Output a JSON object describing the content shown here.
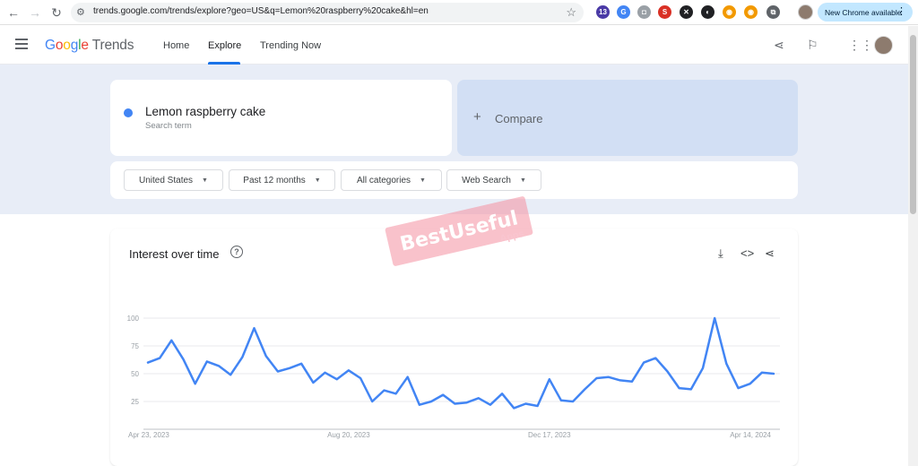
{
  "browser": {
    "url": "trends.google.com/trends/explore?geo=US&q=Lemon%20raspberry%20cake&hl=en",
    "update_label": "New Chrome available",
    "extensions": [
      {
        "name": "hat-extension-icon",
        "text": "13",
        "color": "#4a3aa6"
      },
      {
        "name": "translate-extension-icon",
        "text": "G",
        "color": "#4285f4"
      },
      {
        "name": "camera-extension-icon",
        "text": "◘",
        "color": "#9aa0a6"
      },
      {
        "name": "s-extension-icon",
        "text": "S",
        "color": "#d93025"
      },
      {
        "name": "x-extension-icon",
        "text": "✕",
        "color": "#202124"
      },
      {
        "name": "half-extension-icon",
        "text": "◐",
        "color": "#202124"
      },
      {
        "name": "orange-extension-icon",
        "text": "◉",
        "color": "#f29900"
      },
      {
        "name": "orange2-extension-icon",
        "text": "◉",
        "color": "#f29900"
      },
      {
        "name": "puzzle-extension-icon",
        "text": "⧉",
        "color": "#5f6368"
      }
    ]
  },
  "header": {
    "logo_google": "Google",
    "logo_product": "Trends",
    "tabs": [
      "Home",
      "Explore",
      "Trending Now"
    ]
  },
  "search": {
    "term": "Lemon raspberry cake",
    "term_sub": "Search term",
    "compare": "Compare",
    "term_color": "#4285f4"
  },
  "filters": [
    "United States",
    "Past 12 months",
    "All categories",
    "Web Search"
  ],
  "watermark": {
    "main": "BestUseful",
    "sub": "Apps"
  },
  "chart_data": {
    "type": "line",
    "title": "Interest over time",
    "y_ticks": [
      "100",
      "75",
      "50",
      "25"
    ],
    "ylim": [
      0,
      100
    ],
    "x_tick_labels": [
      "Apr 23, 2023",
      "Aug 20, 2023",
      "Dec 17, 2023",
      "Apr 14, 2024"
    ],
    "x_tick_index": [
      0,
      17,
      34,
      51
    ],
    "series": [
      {
        "color": "#4285f4",
        "values": [
          60,
          64,
          80,
          63,
          41,
          61,
          57,
          49,
          65,
          91,
          66,
          52,
          55,
          59,
          42,
          51,
          45,
          53,
          46,
          25,
          35,
          32,
          47,
          22,
          25,
          31,
          23,
          24,
          28,
          22,
          32,
          19,
          23,
          21,
          45,
          26,
          25,
          36,
          46,
          47,
          44,
          43,
          60,
          64,
          52,
          37,
          36,
          55,
          100,
          59,
          37,
          41,
          51,
          50
        ]
      }
    ]
  }
}
